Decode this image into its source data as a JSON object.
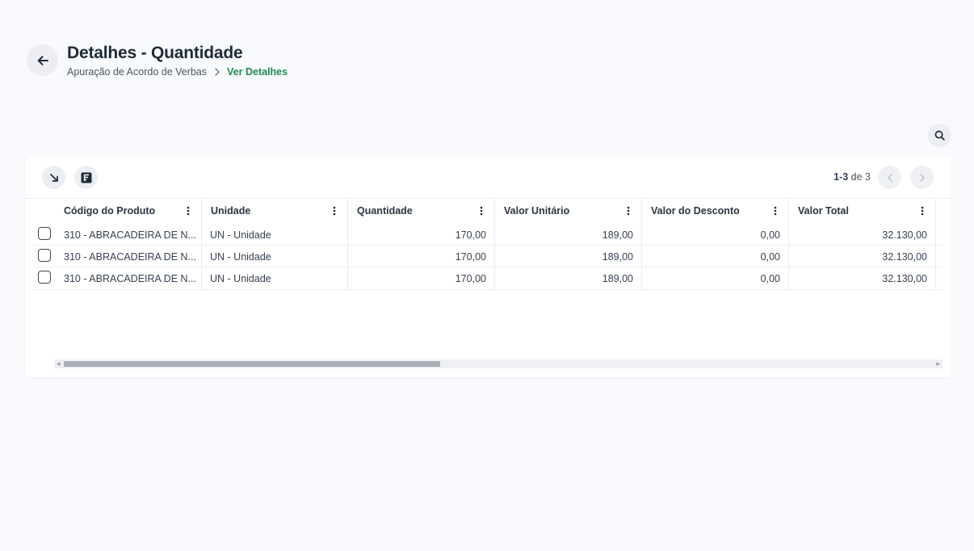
{
  "header": {
    "title": "Detalhes - Quantidade",
    "breadcrumb": {
      "parent": "Apuração de Acordo de Verbas",
      "current": "Ver Detalhes"
    }
  },
  "pagination": {
    "range": "1-3",
    "of": "de 3"
  },
  "table": {
    "columns": [
      "Código do Produto",
      "Unidade",
      "Quantidade",
      "Valor Unitário",
      "Valor do Desconto",
      "Valor Total"
    ],
    "rows": [
      {
        "produto": "310 - ABRACADEIRA DE N...",
        "unidade": "UN - Unidade",
        "quantidade": "170,00",
        "valor_unitario": "189,00",
        "valor_desconto": "0,00",
        "valor_total": "32.130,00"
      },
      {
        "produto": "310 - ABRACADEIRA DE N...",
        "unidade": "UN - Unidade",
        "quantidade": "170,00",
        "valor_unitario": "189,00",
        "valor_desconto": "0,00",
        "valor_total": "32.130,00"
      },
      {
        "produto": "310 - ABRACADEIRA DE N...",
        "unidade": "UN - Unidade",
        "quantidade": "170,00",
        "valor_unitario": "189,00",
        "valor_desconto": "0,00",
        "valor_total": "32.130,00"
      }
    ]
  },
  "icons": {
    "back": "arrow-left-icon",
    "search": "search-icon",
    "expand": "arrow-down-right-icon",
    "export": "spreadsheet-icon",
    "prev": "chevron-left-icon",
    "next": "chevron-right-icon",
    "column_menu": "more-vertical-icon"
  },
  "colors": {
    "accent": "#1f8a55",
    "background": "#f8fafd"
  }
}
